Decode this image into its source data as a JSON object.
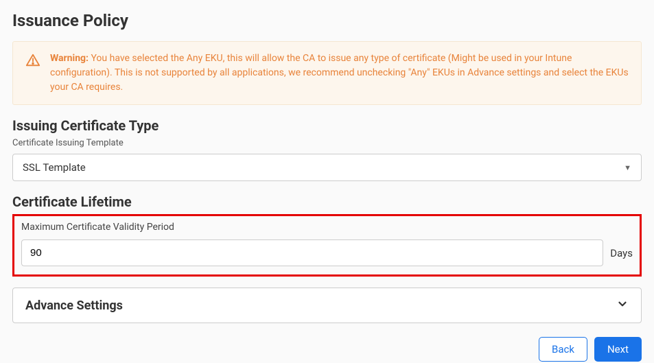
{
  "page": {
    "title": "Issuance Policy"
  },
  "warning": {
    "label": "Warning:",
    "text": " You have selected the Any EKU, this will allow the CA to issue any type of certificate (Might be used in your Intune configuration). This is not supported by all applications, we recommend unchecking \"Any\" EKUs in Advance settings and select the EKUs your CA requires."
  },
  "sections": {
    "issuingType": {
      "heading": "Issuing Certificate Type",
      "templateLabel": "Certificate Issuing Template",
      "templateValue": "SSL Template"
    },
    "lifetime": {
      "heading": "Certificate Lifetime",
      "validityLabel": "Maximum Certificate Validity Period",
      "validityValue": "90",
      "validityUnit": "Days"
    },
    "advance": {
      "label": "Advance Settings"
    }
  },
  "buttons": {
    "back": "Back",
    "next": "Next"
  }
}
